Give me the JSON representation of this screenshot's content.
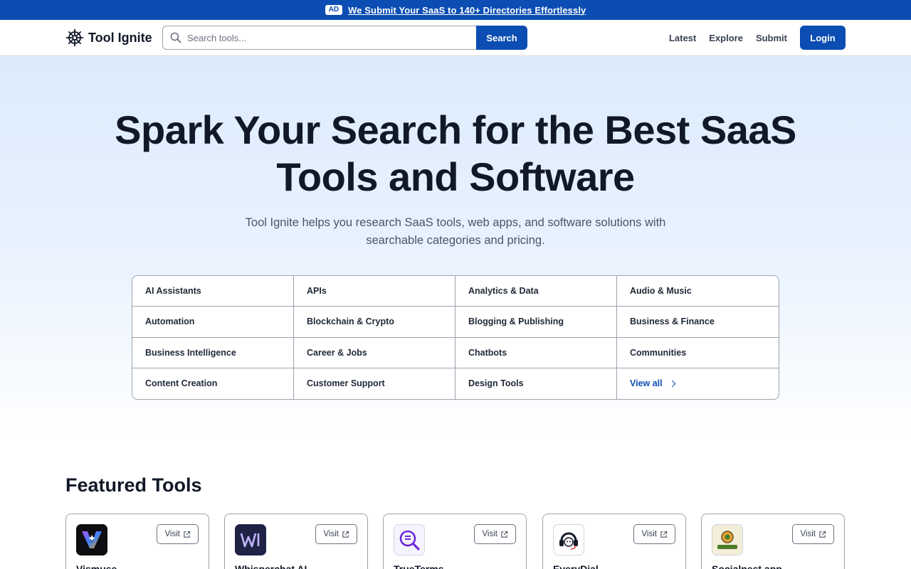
{
  "ad": {
    "badge": "AD",
    "text": "We Submit Your SaaS to 140+ Directories Effortlessly"
  },
  "header": {
    "brand": "Tool Ignite",
    "search_placeholder": "Search tools...",
    "search_button": "Search",
    "nav": [
      "Latest",
      "Explore",
      "Submit"
    ],
    "login": "Login"
  },
  "hero": {
    "title": "Spark Your Search for the Best SaaS Tools and Software",
    "subtitle": "Tool Ignite helps you research SaaS tools, web apps, and software solutions with searchable categories and pricing."
  },
  "categories": [
    "AI Assistants",
    "APIs",
    "Analytics & Data",
    "Audio & Music",
    "Automation",
    "Blockchain & Crypto",
    "Blogging & Publishing",
    "Business & Finance",
    "Business Intelligence",
    "Career & Jobs",
    "Chatbots",
    "Communities",
    "Content Creation",
    "Customer Support",
    "Design Tools"
  ],
  "view_all": "View all",
  "featured": {
    "title": "Featured Tools",
    "visit_label": "Visit",
    "tools": [
      {
        "name": "Vismuse",
        "logo": "vismuse-logo"
      },
      {
        "name": "Whisperchat AI",
        "logo": "whisperchat-logo"
      },
      {
        "name": "TrueTerms",
        "logo": "trueterms-logo"
      },
      {
        "name": "EveryDial",
        "logo": "everydial-logo"
      },
      {
        "name": "Socialnest.app",
        "logo": "socialnest-logo"
      }
    ]
  },
  "colors": {
    "brand": "#0b4db3",
    "text": "#111827",
    "hero_top": "#dcebfc"
  }
}
